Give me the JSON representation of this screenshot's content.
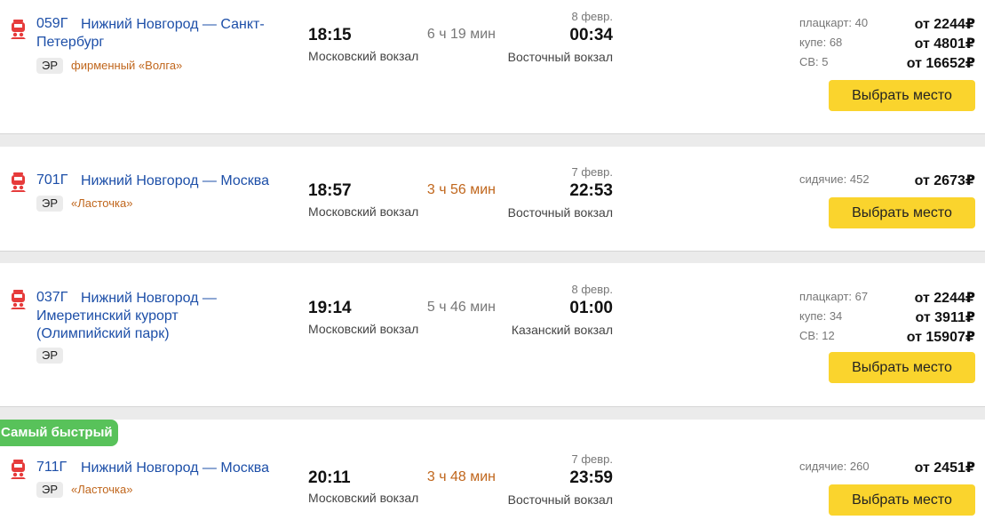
{
  "trains": [
    {
      "number": "059Г",
      "route": "Нижний Новгород — Санкт-Петербург",
      "badge": "ЭР",
      "brand": "фирменный «Волга»",
      "dep_time": "18:15",
      "dep_station": "Московский вокзал",
      "duration": "6 ч 19 мин",
      "arr_date": "8 февр.",
      "arr_time": "00:34",
      "arr_station": "Восточный вокзал",
      "classes": [
        {
          "name": "плацкарт: 40",
          "price": "от 2244₽"
        },
        {
          "name": "купе: 68",
          "price": "от 4801₽"
        },
        {
          "name": "СВ: 5",
          "price": "от 16652₽"
        }
      ],
      "button": "Выбрать место"
    },
    {
      "number": "701Г",
      "route": "Нижний Новгород — Москва",
      "badge": "ЭР",
      "brand": "«Ласточка»",
      "dep_time": "18:57",
      "dep_station": "Московский вокзал",
      "duration": "3 ч 56 мин",
      "arr_date": "7 февр.",
      "arr_time": "22:53",
      "arr_station": "Восточный вокзал",
      "classes": [
        {
          "name": "сидячие: 452",
          "price": "от 2673₽"
        }
      ],
      "button": "Выбрать место"
    },
    {
      "number": "037Г",
      "route": "Нижний Новгород — Имеретинский курорт (Олимпийский парк)",
      "badge": "ЭР",
      "brand": "",
      "dep_time": "19:14",
      "dep_station": "Московский вокзал",
      "duration": "5 ч 46 мин",
      "arr_date": "8 февр.",
      "arr_time": "01:00",
      "arr_station": "Казанский вокзал",
      "classes": [
        {
          "name": "плацкарт: 67",
          "price": "от 2244₽"
        },
        {
          "name": "купе: 34",
          "price": "от 3911₽"
        },
        {
          "name": "СВ: 12",
          "price": "от 15907₽"
        }
      ],
      "button": "Выбрать место"
    },
    {
      "label": "Самый быстрый",
      "number": "711Г",
      "route": "Нижний Новгород — Москва",
      "badge": "ЭР",
      "brand": "«Ласточка»",
      "dep_time": "20:11",
      "dep_station": "Московский вокзал",
      "duration": "3 ч 48 мин",
      "arr_date": "7 февр.",
      "arr_time": "23:59",
      "arr_station": "Восточный вокзал",
      "classes": [
        {
          "name": "сидячие: 260",
          "price": "от 2451₽"
        }
      ],
      "button": "Выбрать место"
    }
  ],
  "colors": {
    "link": "#1d4fa8",
    "brand": "#c0661c",
    "button": "#fad42d",
    "fastest_badge": "#58c25a",
    "train_icon": "#e63b3b"
  },
  "icons": {
    "train": "locomotive-icon"
  }
}
